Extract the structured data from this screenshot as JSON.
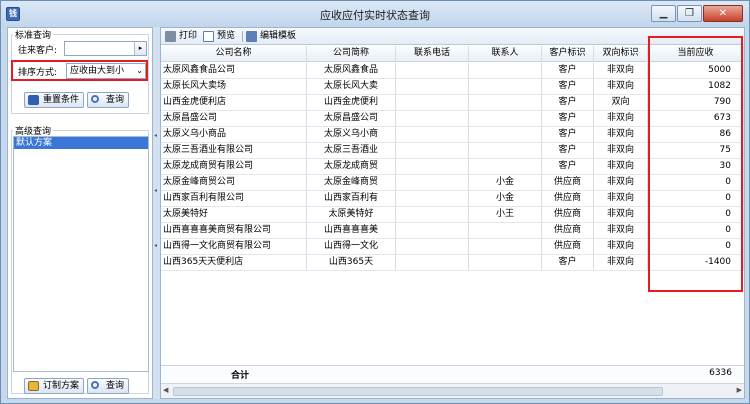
{
  "window": {
    "title": "应收应付实时状态查询",
    "icon_letter": "钱"
  },
  "left": {
    "group_standard": "标准查询",
    "customer_label": "往来客户:",
    "customer_value": "",
    "sort_label": "排序方式:",
    "sort_value": "应收由大到小",
    "reset_label": "重置条件",
    "query_label": "查询",
    "group_advanced": "高级查询",
    "plans": [
      "默认方案"
    ],
    "custom_plan_label": "订制方案",
    "query2_label": "查询"
  },
  "toolbar": {
    "print": "打印",
    "preview": "预览",
    "edit_template": "编辑模板"
  },
  "table": {
    "headers": [
      "公司名称",
      "公司简称",
      "联系电话",
      "联系人",
      "客户标识",
      "双向标识",
      "当前应收"
    ],
    "rows": [
      [
        "太原风鑫食品公司",
        "太原风鑫食品",
        "",
        "",
        "客户",
        "非双向",
        "5000"
      ],
      [
        "太原长风大卖场",
        "太原长风大卖",
        "",
        "",
        "客户",
        "非双向",
        "1082"
      ],
      [
        "山西金虎便利店",
        "山西金虎便利",
        "",
        "",
        "客户",
        "双向",
        "790"
      ],
      [
        "太原昌盛公司",
        "太原昌盛公司",
        "",
        "",
        "客户",
        "非双向",
        "673"
      ],
      [
        "太原义乌小商品",
        "太原义乌小商",
        "",
        "",
        "客户",
        "非双向",
        "86"
      ],
      [
        "太原三吾酒业有限公司",
        "太原三吾酒业",
        "",
        "",
        "客户",
        "非双向",
        "75"
      ],
      [
        "太原龙成商贸有限公司",
        "太原龙成商贸",
        "",
        "",
        "客户",
        "非双向",
        "30"
      ],
      [
        "太原金峰商贸公司",
        "太原金峰商贸",
        "",
        "小金",
        "供应商",
        "非双向",
        "0"
      ],
      [
        "山西家百利有限公司",
        "山西家百利有",
        "",
        "小金",
        "供应商",
        "非双向",
        "0"
      ],
      [
        "太原美特好",
        "太原美特好",
        "",
        "小王",
        "供应商",
        "非双向",
        "0"
      ],
      [
        "山西喜喜喜美商贸有限公司",
        "山西喜喜喜美",
        "",
        "",
        "供应商",
        "非双向",
        "0"
      ],
      [
        "山西得一文化商贸有限公司",
        "山西得一文化",
        "",
        "",
        "供应商",
        "非双向",
        "0"
      ],
      [
        "山西365天天便利店",
        "山西365天",
        "",
        "",
        "客户",
        "非双向",
        "-1400"
      ]
    ],
    "total_label": "合计",
    "total_value": "6336"
  },
  "colors": {
    "accent_highlight": "#e01c24",
    "selection": "#3976d6"
  }
}
